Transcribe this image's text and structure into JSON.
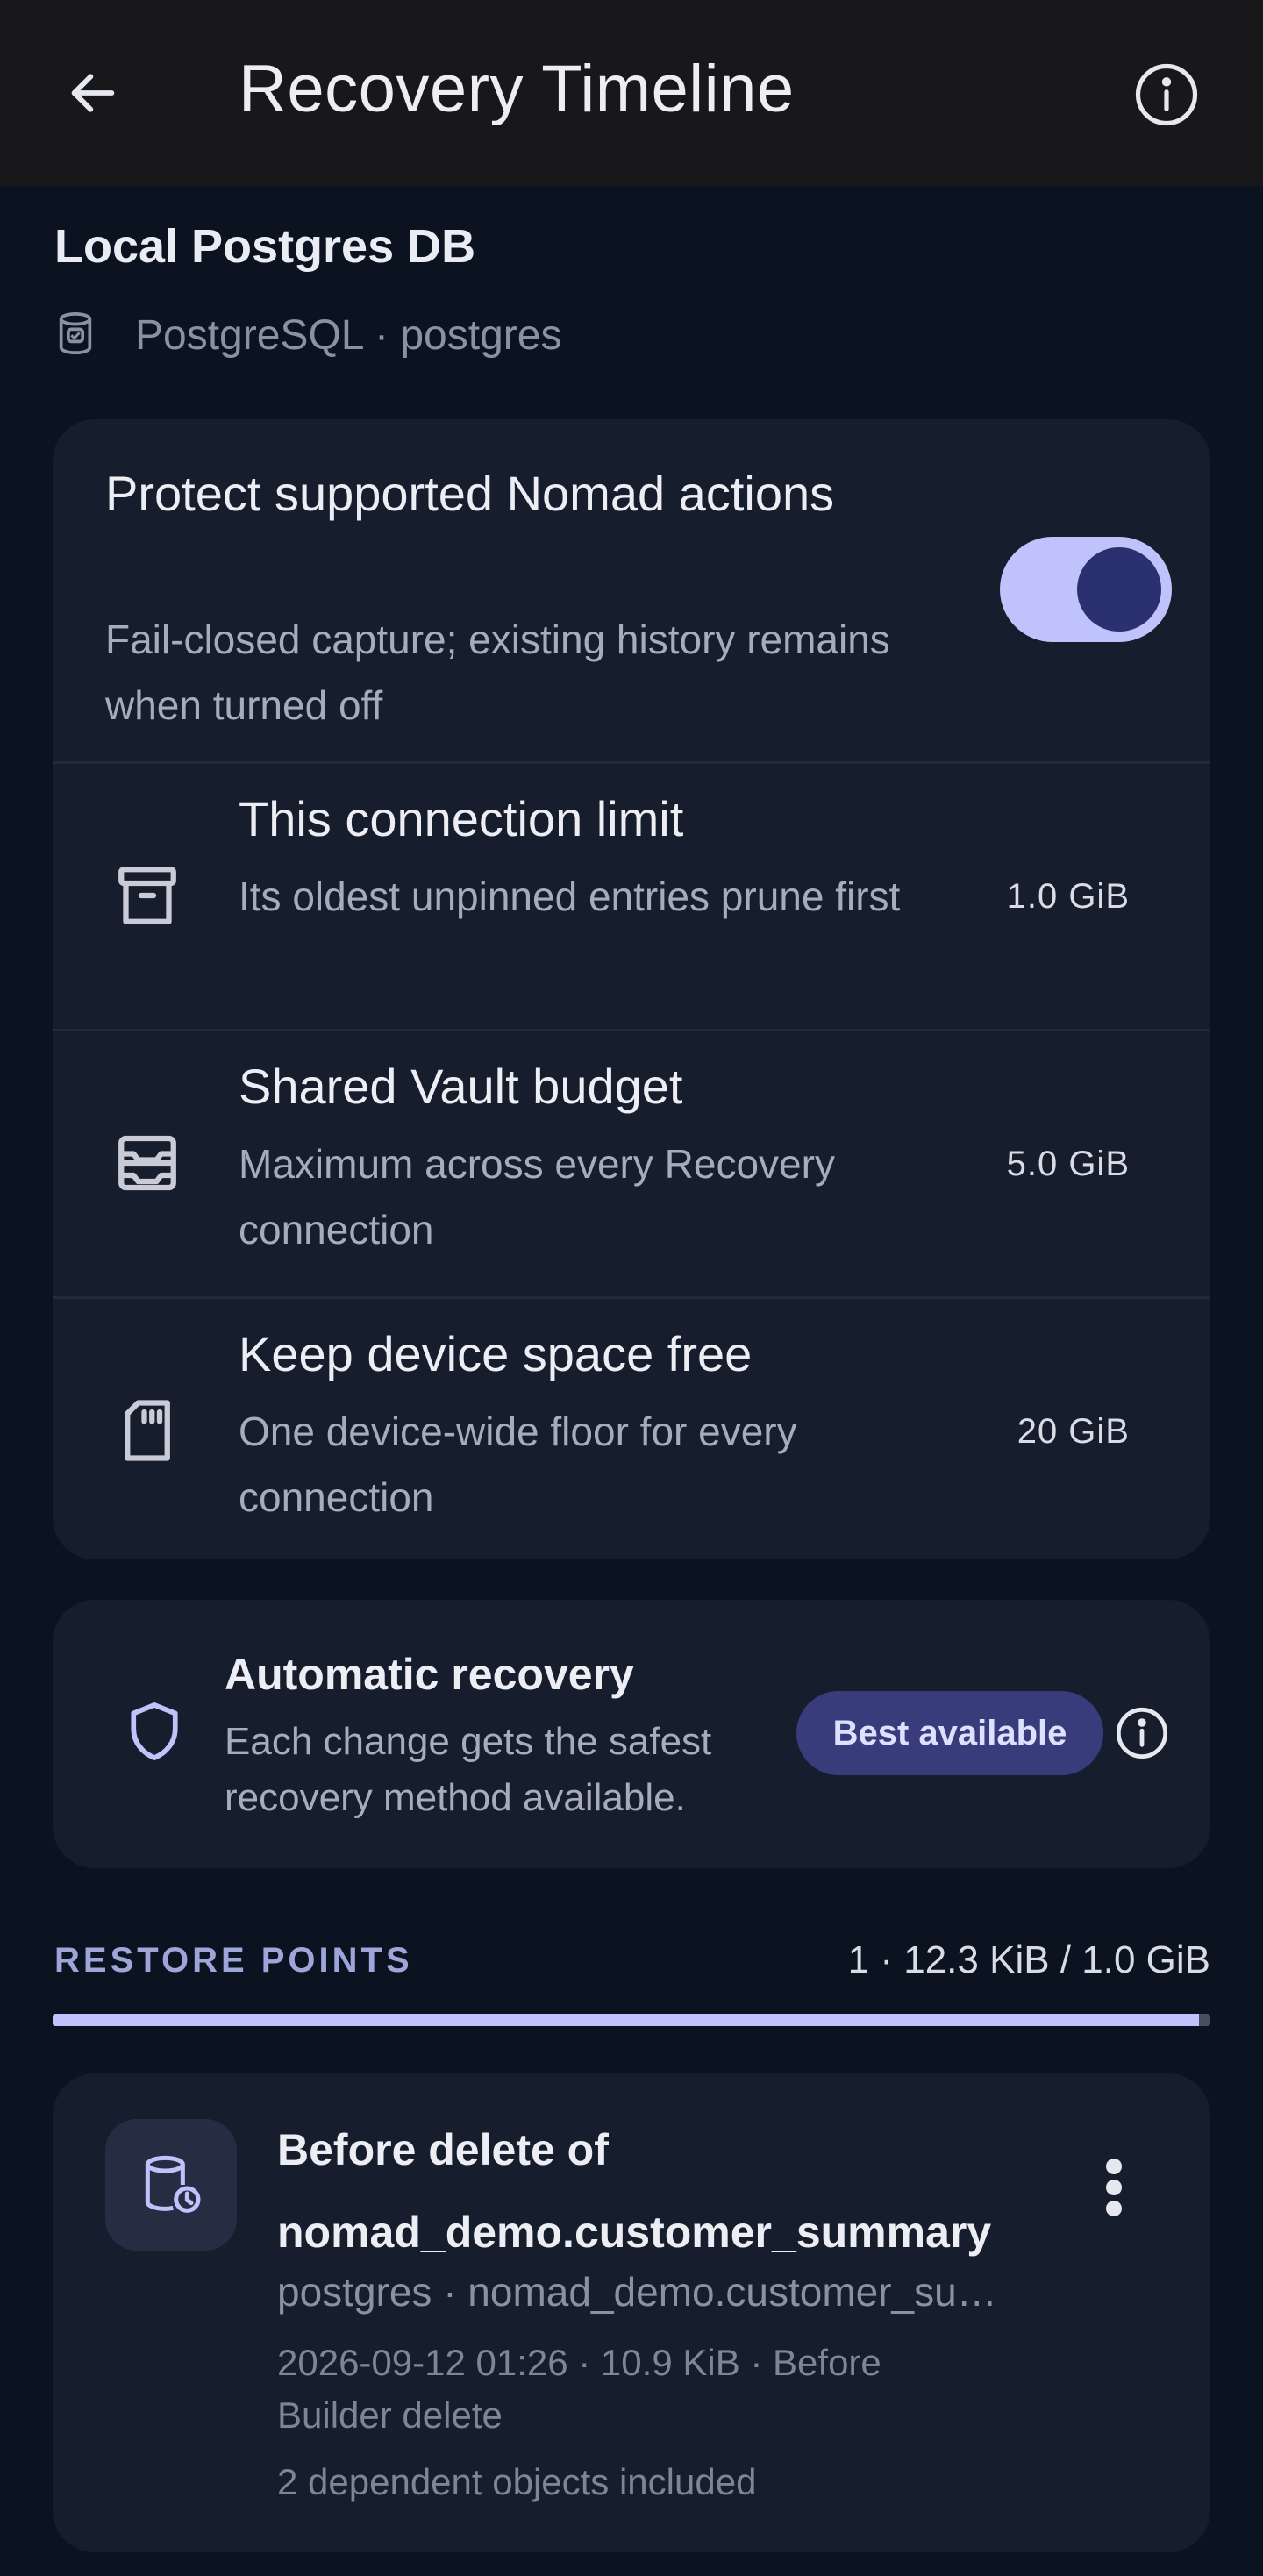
{
  "header": {
    "title": "Recovery Timeline",
    "back_icon": "arrow-back-icon",
    "info_icon": "info-icon"
  },
  "connection": {
    "name": "Local Postgres DB",
    "subtitle": "PostgreSQL · postgres",
    "icon": "database-icon"
  },
  "protection": {
    "title": "Protect supported Nomad actions",
    "description": "Fail-closed capture; existing history remains when turned off",
    "enabled": true
  },
  "settings": [
    {
      "icon": "archive-icon",
      "title": "This connection limit",
      "description": "Its oldest unpinned entries prune first",
      "value": "1.0 GiB"
    },
    {
      "icon": "inbox-tray-icon",
      "title": "Shared Vault budget",
      "description": "Maximum across every Recovery connection",
      "value": "5.0 GiB"
    },
    {
      "icon": "sd-card-icon",
      "title": "Keep device space free",
      "description": "One device-wide floor for every connection",
      "value": "20 GiB"
    }
  ],
  "auto_recovery": {
    "icon": "shield-icon",
    "title": "Automatic recovery",
    "description": "Each change gets the safest recovery method available.",
    "chip_label": "Best available"
  },
  "restore_points": {
    "section_label": "RESTORE POINTS",
    "stats": "1 · 12.3 KiB / 1.0 GiB",
    "usage_fraction": 0.99,
    "items": [
      {
        "icon": "database-clock-icon",
        "title": "Before delete of nomad_demo.customer_summary",
        "meta_line1": "postgres · nomad_demo.customer_su…",
        "meta_line2": "2026-09-12 01:26 · 10.9 KiB · Before Builder delete",
        "meta_line3": "2 dependent objects included"
      }
    ]
  },
  "colors": {
    "background": "#0b1220",
    "app_bar": "#18181b",
    "card": "#161d2c",
    "accent": "#c0c3fb",
    "chip": "#383c7a"
  }
}
